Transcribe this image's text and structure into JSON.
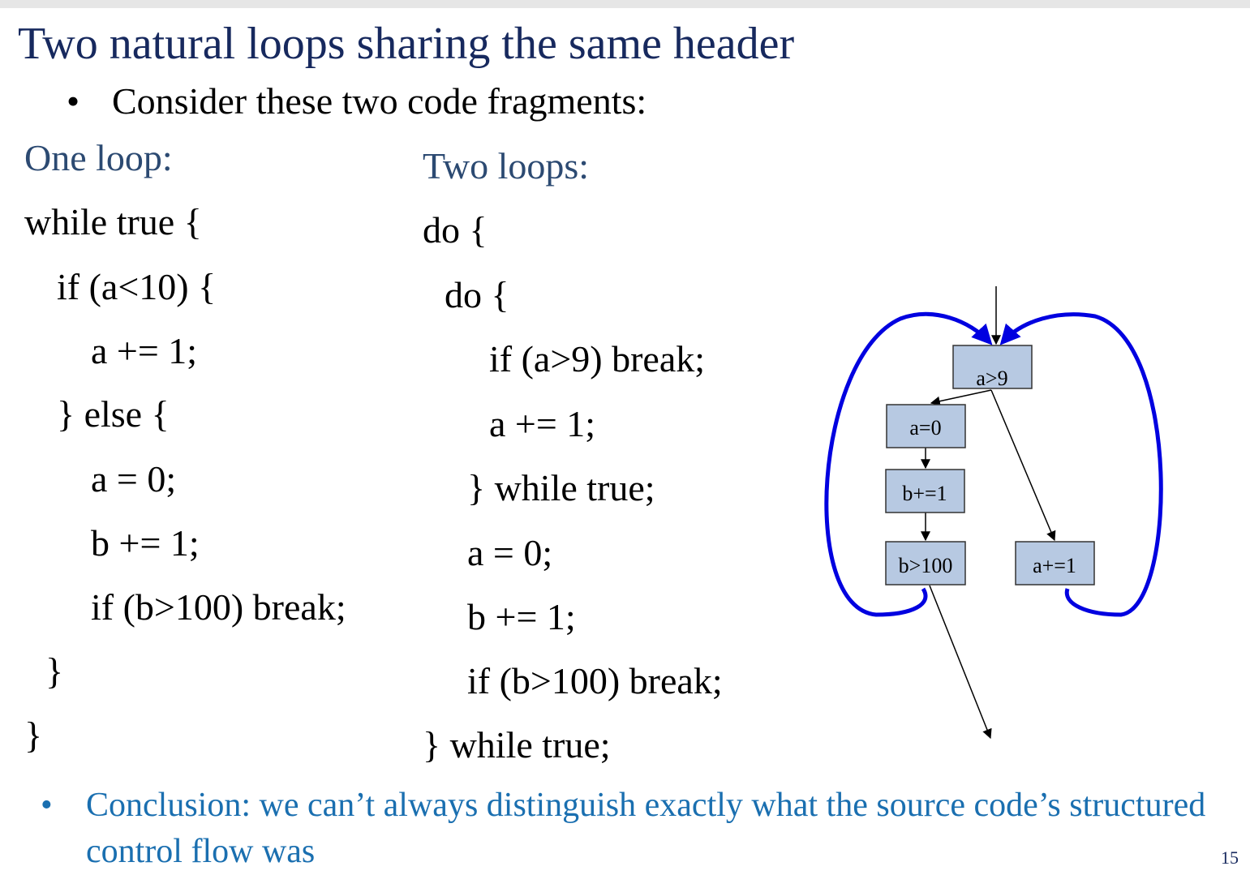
{
  "title": "Two natural loops sharing the same header",
  "intro_bullet": "Consider these two code fragments:",
  "one_loop": {
    "heading": "One loop:",
    "lines": [
      "while true {",
      "if (a<10) {",
      "a += 1;",
      "} else {",
      "a = 0;",
      "b += 1;",
      "if (b>100) break;",
      "}",
      "}"
    ]
  },
  "two_loops": {
    "heading": "Two loops:",
    "lines": [
      "do {",
      "do {",
      "if (a>9) break;",
      "a += 1;",
      "} while true;",
      "a = 0;",
      "b += 1;",
      "if (b>100) break;",
      "} while true;"
    ]
  },
  "diagram": {
    "nodes": {
      "header": "a>9",
      "reset": "a=0",
      "inc_b": "b+=1",
      "test_b": "b>100",
      "inc_a": "a+=1"
    },
    "colors": {
      "loop_edge": "#0000e0",
      "node_fill": "#b7c9e2"
    }
  },
  "conclusion": "Conclusion: we can’t always distinguish exactly what the source code’s structured control flow was",
  "page_number": "15"
}
